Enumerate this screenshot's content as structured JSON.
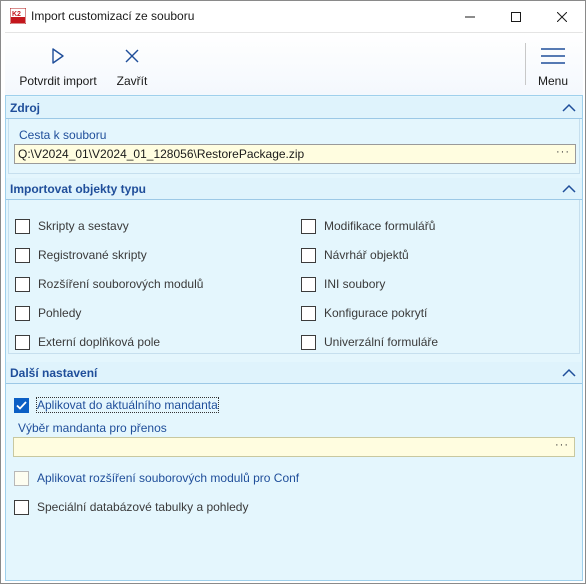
{
  "window": {
    "title": "Import customizací ze souboru"
  },
  "toolbar": {
    "confirm_label": "Potvrdit import",
    "close_label": "Zavřít",
    "menu_label": "Menu"
  },
  "source": {
    "title": "Zdroj",
    "path_label": "Cesta k souboru",
    "path_value": "Q:\\V2024_01\\V2024_01_128056\\RestorePackage.zip",
    "ellipsis": "···"
  },
  "import_types": {
    "title": "Importovat objekty typu",
    "left": [
      {
        "label": "Skripty a sestavy",
        "checked": false
      },
      {
        "label": "Registrované skripty",
        "checked": false
      },
      {
        "label": "Rozšíření souborových modulů",
        "checked": false
      },
      {
        "label": "Pohledy",
        "checked": false
      },
      {
        "label": "Externí doplňková pole",
        "checked": false
      }
    ],
    "right": [
      {
        "label": "Modifikace formulářů",
        "checked": false
      },
      {
        "label": "Návrhář objektů",
        "checked": false
      },
      {
        "label": "INI soubory",
        "checked": false
      },
      {
        "label": "Konfigurace pokrytí",
        "checked": false
      },
      {
        "label": "Univerzální formuláře",
        "checked": false
      }
    ]
  },
  "other_settings": {
    "title": "Další nastavení",
    "apply_current_label": "Aplikovat do aktuálního mandanta",
    "apply_current_checked": true,
    "mandant_select_label": "Výběr mandanta pro přenos",
    "mandant_select_value": "",
    "ellipsis": "···",
    "apply_extensions_label": "Aplikovat rozšíření souborových modulů pro Conf",
    "apply_extensions_checked": false,
    "special_tables_label": "Speciální databázové tabulky a pohledy",
    "special_tables_checked": false
  },
  "colors": {
    "accent": "#1f4e9a",
    "panel_bg": "#e4f6fd",
    "checkbox_checked": "#0b5fc5"
  }
}
